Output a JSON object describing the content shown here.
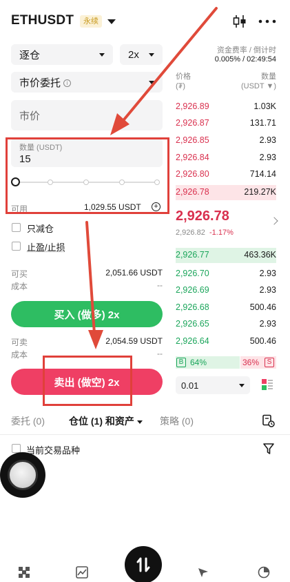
{
  "header": {
    "symbol": "ETHUSDT",
    "tag": "永续"
  },
  "form": {
    "margin_mode": "逐仓",
    "leverage": "2x",
    "order_type": "市价委托",
    "price_placeholder": "市价",
    "qty_label": "数量 (USDT)",
    "qty_value": "15",
    "available_label": "可用",
    "available_value": "1,029.55 USDT",
    "reduce_only": "只减仓",
    "tp_sl": "止盈/止损",
    "can_buy_label": "可买",
    "can_buy_value": "2,051.66 USDT",
    "cost_label": "成本",
    "cost_value": "--",
    "buy_btn": "买入 (做多) 2x",
    "can_sell_label": "可卖",
    "can_sell_value": "2,054.59 USDT",
    "cost2_label": "成本",
    "cost2_value": "--",
    "sell_btn": "卖出 (做空) 2x"
  },
  "orderbook": {
    "funding_label": "资金费率 / 倒计时",
    "funding_value": "0.005% / 02:49:54",
    "price_col": "价格",
    "price_unit": "(₮)",
    "qty_col": "数量",
    "qty_unit": "(USDT ▼)",
    "asks": [
      {
        "p": "2,926.89",
        "q": "1.03K"
      },
      {
        "p": "2,926.87",
        "q": "131.71"
      },
      {
        "p": "2,926.85",
        "q": "2.93"
      },
      {
        "p": "2,926.84",
        "q": "2.93"
      },
      {
        "p": "2,926.80",
        "q": "714.14"
      },
      {
        "p": "2,926.78",
        "q": "219.27K"
      }
    ],
    "last_price": "2,926.78",
    "mark_price": "2,926.82",
    "change": "-1.17%",
    "bids": [
      {
        "p": "2,926.77",
        "q": "463.36K"
      },
      {
        "p": "2,926.70",
        "q": "2.93"
      },
      {
        "p": "2,926.69",
        "q": "2.93"
      },
      {
        "p": "2,926.68",
        "q": "500.46"
      },
      {
        "p": "2,926.65",
        "q": "2.93"
      },
      {
        "p": "2,926.64",
        "q": "500.46"
      }
    ],
    "buy_tag": "B",
    "buy_pct": "64%",
    "sell_pct": "36%",
    "sell_tag": "S",
    "buy_ratio": 0.64,
    "step": "0.01"
  },
  "tabs": {
    "orders": "委托 (0)",
    "positions": "仓位 (1) 和资产",
    "strategy": "策略 (0)"
  },
  "filter": {
    "current_symbol": "当前交易品种"
  },
  "colors": {
    "buy": "#2ebd62",
    "sell": "#ef3f64",
    "annotation": "#e0403a"
  }
}
